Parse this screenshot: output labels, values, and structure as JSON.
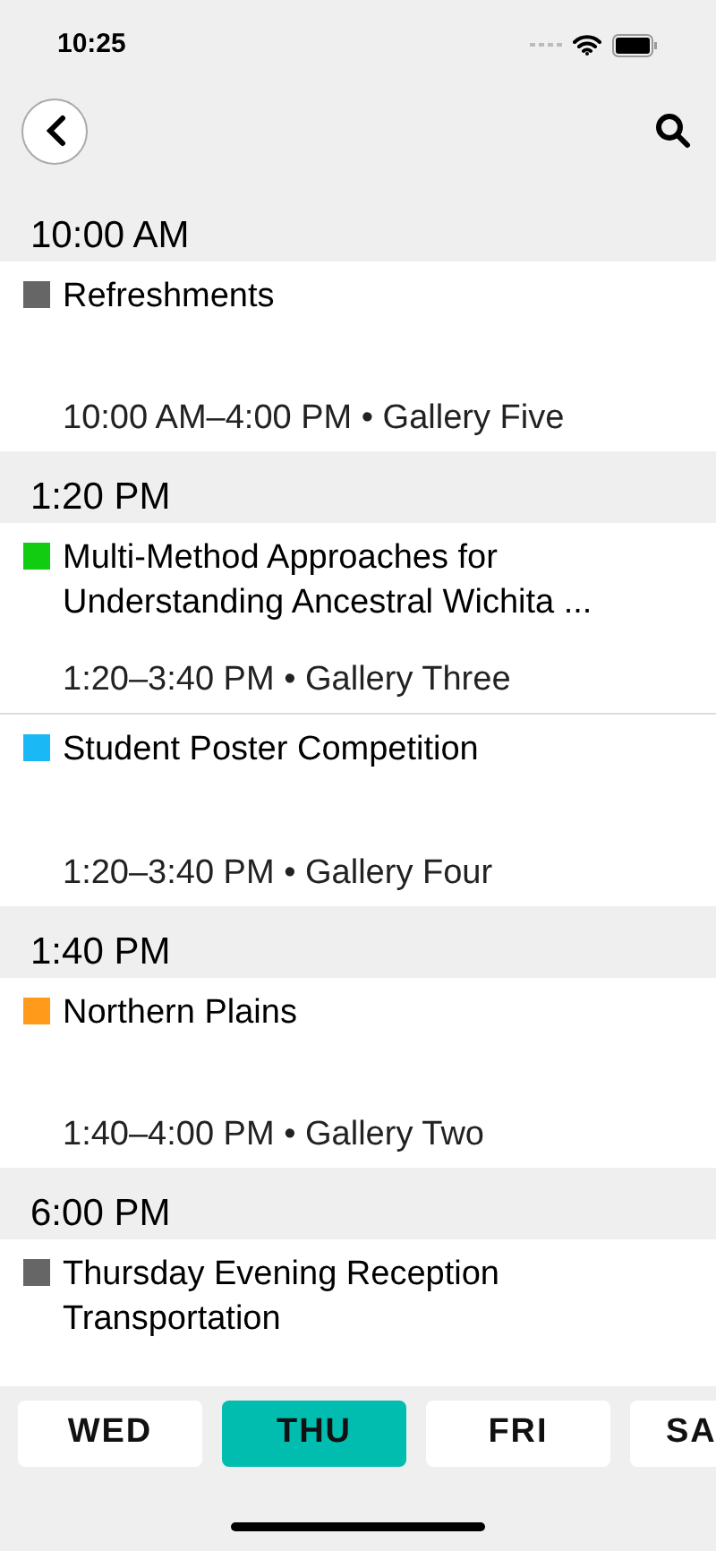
{
  "status_bar": {
    "time": "10:25"
  },
  "sections": [
    {
      "time": "10:00 AM",
      "events": [
        {
          "title": "Refreshments",
          "time": "10:00 AM–4:00 PM • Gallery Five",
          "color": "#666666"
        }
      ]
    },
    {
      "time": "1:20 PM",
      "events": [
        {
          "title": "Multi-Method Approaches for Understanding Ancestral Wichita ...",
          "time": "1:20–3:40 PM • Gallery Three",
          "color": "#11cc11"
        },
        {
          "title": "Student Poster Competition",
          "time": "1:20–3:40 PM • Gallery Four",
          "color": "#1ab8f5"
        }
      ]
    },
    {
      "time": "1:40 PM",
      "events": [
        {
          "title": "Northern Plains",
          "time": "1:40–4:00 PM • Gallery Two",
          "color": "#ff9a1a"
        }
      ]
    },
    {
      "time": "6:00 PM",
      "events": [
        {
          "title": "Thursday Evening Reception Transportation",
          "color": "#666666"
        }
      ]
    }
  ],
  "day_tabs": [
    {
      "label": "WED",
      "selected": false
    },
    {
      "label": "THU",
      "selected": true
    },
    {
      "label": "FRI",
      "selected": false
    },
    {
      "label": "SA",
      "selected": false
    }
  ]
}
